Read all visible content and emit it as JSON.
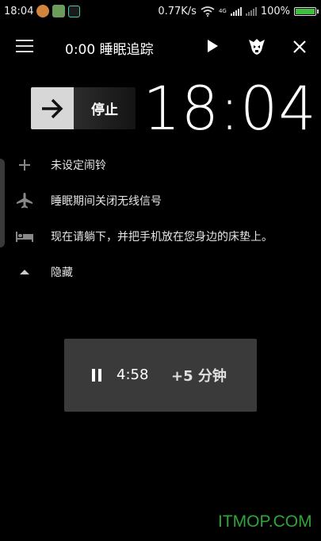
{
  "status_bar": {
    "time": "18:04",
    "speed": "0.77K/s",
    "signal_tag": "4G",
    "battery": "100%",
    "battery_level": 1.0
  },
  "toolbar": {
    "title": "0:00 睡眠追踪"
  },
  "stop": {
    "label": "停止"
  },
  "clock": "18:04",
  "info_rows": [
    {
      "icon": "plus-icon",
      "text": "未设定闹铃"
    },
    {
      "icon": "airplane-icon",
      "text": "睡眠期间关闭无线信号"
    },
    {
      "icon": "bed-icon",
      "text": "现在请躺下，并把手机放在您身边的床垫上。"
    },
    {
      "icon": "collapse-arrow-icon",
      "text": "隐藏"
    }
  ],
  "timer": {
    "value": "4:58",
    "extend_label": "+5 分钟"
  },
  "watermark": "ITMOP.COM"
}
